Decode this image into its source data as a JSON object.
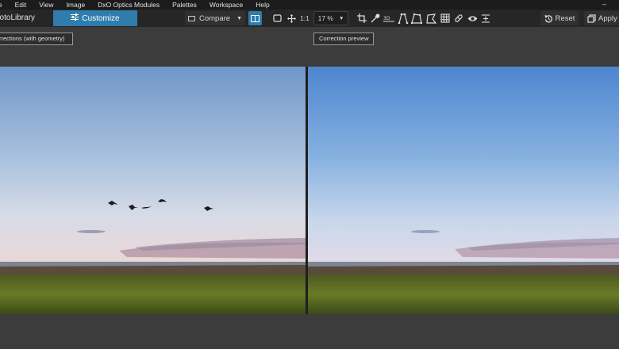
{
  "menu": {
    "items": [
      "le",
      "Edit",
      "View",
      "Image",
      "DxO Optics Modules",
      "Palettes",
      "Workspace",
      "Help"
    ],
    "window_minimize": "–"
  },
  "toolbar": {
    "tab_photolibrary": "hotoLibrary",
    "tab_customize": "Customize",
    "compare_label": "Compare",
    "one_to_one": "1:1",
    "zoom_value": "17 %",
    "reset_label": "Reset",
    "apply_label": "Apply",
    "tools": [
      "crop-icon",
      "white-balance-picker-icon",
      "horizon-icon",
      "volume-deformation-icon",
      "perspective-icon",
      "polygon-perspective-icon",
      "grid-icon",
      "repair-icon",
      "red-eye-icon",
      "mask-icon"
    ]
  },
  "viewer": {
    "left_label": "rrections (with geometry)",
    "right_label": "Correction preview"
  },
  "colors": {
    "accent": "#2f7dac",
    "menubar_bg": "#1b1b1b",
    "toolbar_bg": "#262626",
    "workspace_bg": "#3c3c3c"
  }
}
